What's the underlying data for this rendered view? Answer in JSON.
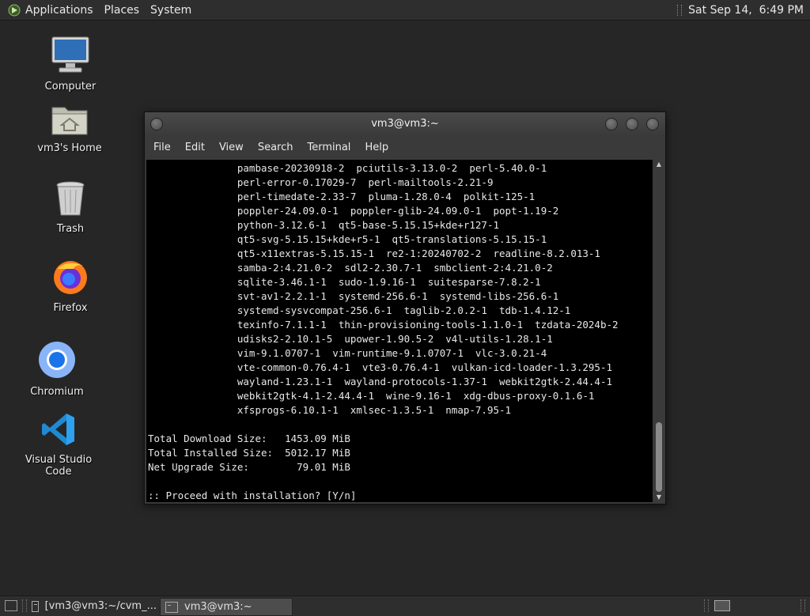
{
  "top_panel": {
    "menus": [
      "Applications",
      "Places",
      "System"
    ],
    "clock": "Sat Sep 14,  6:49 PM"
  },
  "desktop": {
    "icons": [
      {
        "label": "Computer",
        "icon": "computer-icon"
      },
      {
        "label": "vm3's Home",
        "icon": "home-folder-icon"
      },
      {
        "label": "Trash",
        "icon": "trash-icon"
      },
      {
        "label": "Firefox",
        "icon": "firefox-icon"
      },
      {
        "label": "Chromium",
        "icon": "chromium-icon"
      },
      {
        "label": "Visual Studio Code",
        "icon": "vscode-icon"
      }
    ]
  },
  "terminal": {
    "title": "vm3@vm3:~",
    "menu": [
      "File",
      "Edit",
      "View",
      "Search",
      "Terminal",
      "Help"
    ],
    "lines": [
      "               pambase-20230918-2  pciutils-3.13.0-2  perl-5.40.0-1",
      "               perl-error-0.17029-7  perl-mailtools-2.21-9",
      "               perl-timedate-2.33-7  pluma-1.28.0-4  polkit-125-1",
      "               poppler-24.09.0-1  poppler-glib-24.09.0-1  popt-1.19-2",
      "               python-3.12.6-1  qt5-base-5.15.15+kde+r127-1",
      "               qt5-svg-5.15.15+kde+r5-1  qt5-translations-5.15.15-1",
      "               qt5-x11extras-5.15.15-1  re2-1:20240702-2  readline-8.2.013-1",
      "               samba-2:4.21.0-2  sdl2-2.30.7-1  smbclient-2:4.21.0-2",
      "               sqlite-3.46.1-1  sudo-1.9.16-1  suitesparse-7.8.2-1",
      "               svt-av1-2.2.1-1  systemd-256.6-1  systemd-libs-256.6-1",
      "               systemd-sysvcompat-256.6-1  taglib-2.0.2-1  tdb-1.4.12-1",
      "               texinfo-7.1.1-1  thin-provisioning-tools-1.1.0-1  tzdata-2024b-2",
      "               udisks2-2.10.1-5  upower-1.90.5-2  v4l-utils-1.28.1-1",
      "               vim-9.1.0707-1  vim-runtime-9.1.0707-1  vlc-3.0.21-4",
      "               vte-common-0.76.4-1  vte3-0.76.4-1  vulkan-icd-loader-1.3.295-1",
      "               wayland-1.23.1-1  wayland-protocols-1.37-1  webkit2gtk-2.44.4-1",
      "               webkit2gtk-4.1-2.44.4-1  wine-9.16-1  xdg-dbus-proxy-0.1.6-1",
      "               xfsprogs-6.10.1-1  xmlsec-1.3.5-1  nmap-7.95-1",
      "",
      "Total Download Size:   1453.09 MiB",
      "Total Installed Size:  5012.17 MiB",
      "Net Upgrade Size:        79.01 MiB",
      "",
      ":: Proceed with installation? [Y/n]"
    ]
  },
  "taskbar": {
    "tasks": [
      {
        "label": "[vm3@vm3:~/cvm_...",
        "active": false
      },
      {
        "label": "vm3@vm3:~",
        "active": true
      }
    ]
  }
}
